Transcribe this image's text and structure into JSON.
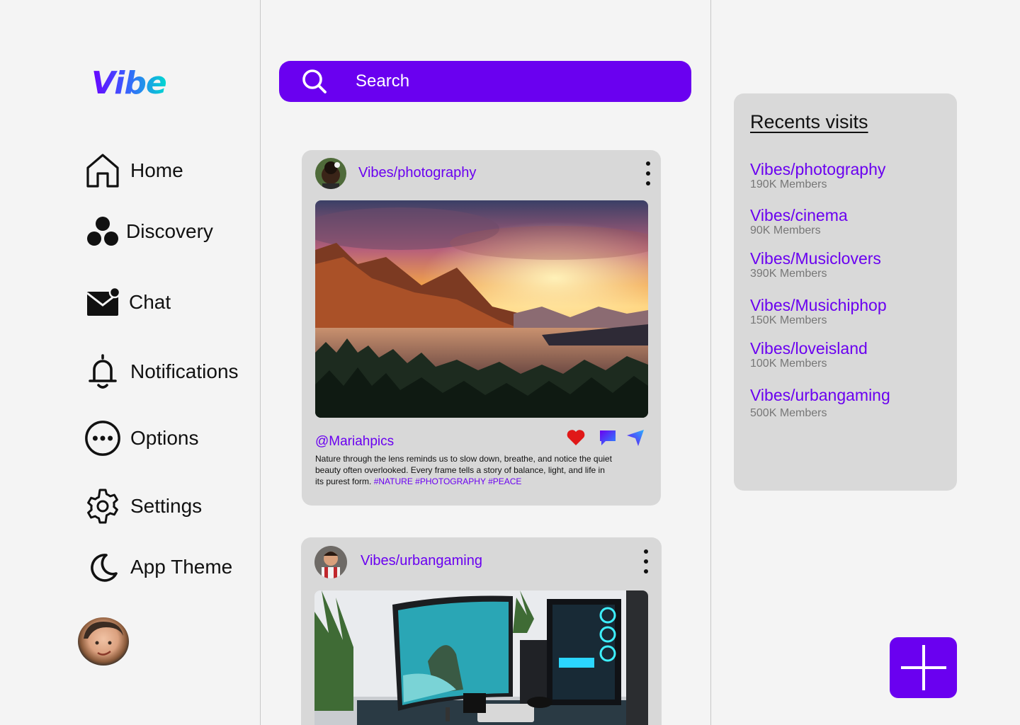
{
  "brand": {
    "name": "Vibe"
  },
  "sidebar": {
    "items": [
      {
        "label": "Home",
        "icon": "home-icon"
      },
      {
        "label": "Discovery",
        "icon": "discovery-icon"
      },
      {
        "label": "Chat",
        "icon": "chat-icon"
      },
      {
        "label": "Notifications",
        "icon": "bell-icon"
      },
      {
        "label": "Options",
        "icon": "more-circle-icon"
      },
      {
        "label": "Settings",
        "icon": "gear-icon"
      },
      {
        "label": "App Theme",
        "icon": "moon-icon"
      }
    ]
  },
  "search": {
    "placeholder": "Search"
  },
  "posts": [
    {
      "community": "Vibes/photography",
      "handle": "@Mariahpics",
      "caption": "Nature through the lens reminds us to slow down, breathe, and notice the quiet beauty often overlooked. Every frame tells a story of balance, light, and life in its purest form.",
      "tags": "#NATURE #PHOTOGRAPHY #PEACE",
      "image": "mountain-lake-sunset"
    },
    {
      "community": "Vibes/urbangaming",
      "image": "gaming-desk-setup"
    }
  ],
  "recents": {
    "title": "Recents visits",
    "items": [
      {
        "name": "Vibes/photography",
        "members": "190K Members"
      },
      {
        "name": "Vibes/cinema",
        "members": "90K Members"
      },
      {
        "name": "Vibes/Musiclovers",
        "members": "390K Members"
      },
      {
        "name": "Vibes/Musichiphop",
        "members": "150K Members"
      },
      {
        "name": "Vibes/loveisland",
        "members": "100K Members"
      },
      {
        "name": "Vibes/urbangaming",
        "members": "500K Members"
      }
    ]
  },
  "colors": {
    "accent": "#6a00f0",
    "like": "#e01818",
    "card": "#d8d8d8",
    "background": "#f4f4f4"
  }
}
